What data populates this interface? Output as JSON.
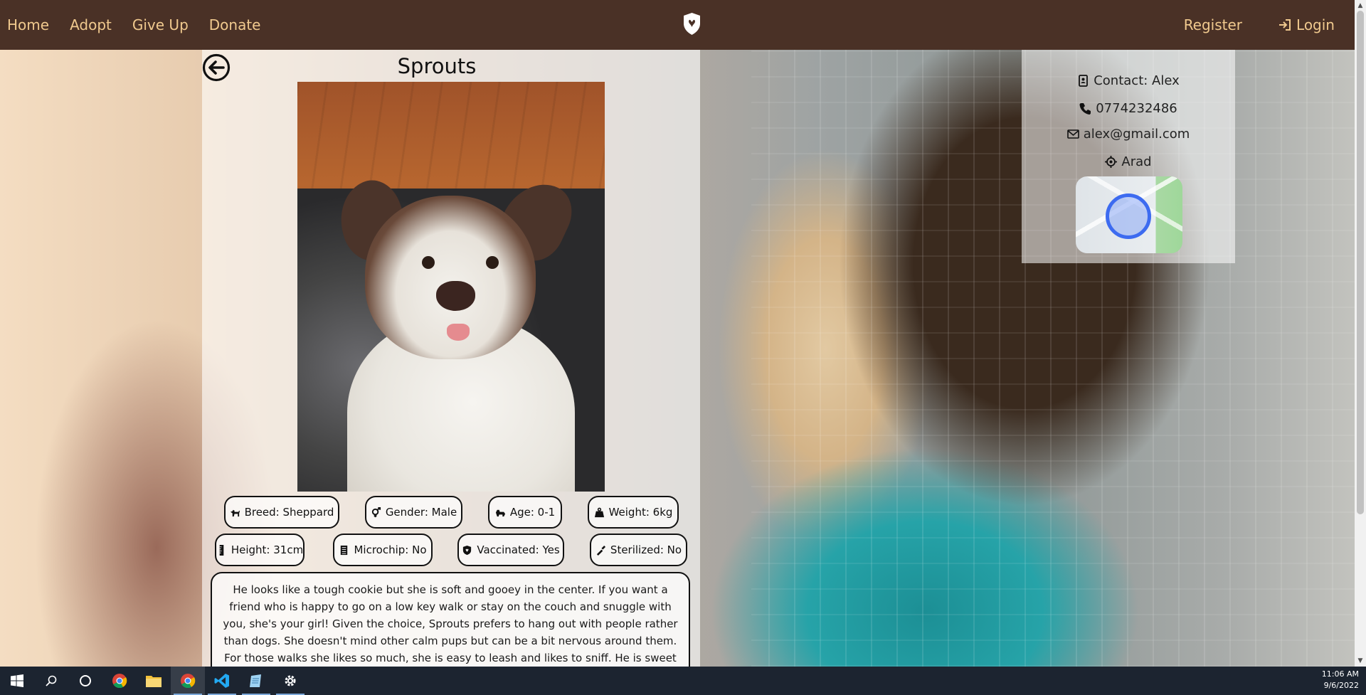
{
  "nav": {
    "links": [
      "Home",
      "Adopt",
      "Give Up",
      "Donate"
    ],
    "register": "Register",
    "login": "Login"
  },
  "pet": {
    "name": "Sprouts",
    "chips": {
      "breed": "Breed: Sheppard",
      "gender": "Gender: Male",
      "age": "Age: 0-1",
      "weight": "Weight: 6kg",
      "height": "Height: 31cm",
      "microchip": "Microchip: No",
      "vaccinated": "Vaccinated: Yes",
      "sterilized": "Sterilized: No"
    },
    "description": "He looks like a tough cookie but she is soft and gooey in the center. If you want a friend who is happy to go on a low key walk or stay on the couch and snuggle with you, she's your girl! Given the choice, Sprouts prefers to hang out with people rather than dogs. She doesn't mind other calm pups but can be a bit nervous around them. For those walks she likes so much, she is easy to leash and likes to sniff. He is sweet treat who is all ready to be"
  },
  "contact": {
    "name": "Contact: Alex",
    "phone": "0774232486",
    "email": "alex@gmail.com",
    "location": "Arad"
  },
  "taskbar": {
    "time": "11:06 AM",
    "date": "9/6/2022",
    "apps": [
      "start-icon",
      "search-icon",
      "cortana-icon",
      "chrome-icon",
      "file-explorer-icon",
      "chrome-active-icon",
      "vscode-icon",
      "notepad-icon",
      "settings-icon"
    ]
  },
  "colors": {
    "navbar": "#4a3126",
    "nav_text": "#f0c98e",
    "taskbar": "#1c2430",
    "map_marker": "#3d6bf0"
  }
}
